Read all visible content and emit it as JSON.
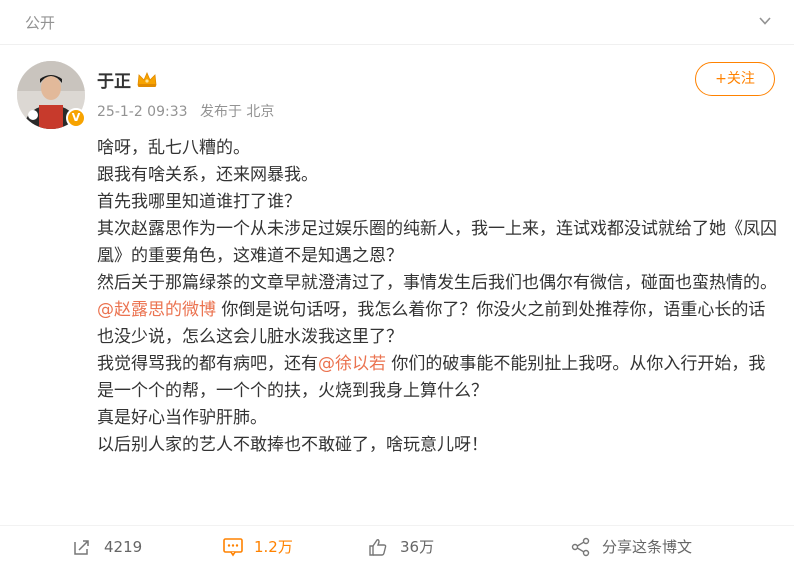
{
  "header": {
    "visibility_label": "公开"
  },
  "author": {
    "name": "于正",
    "verified_badge": "V",
    "timestamp": "25-1-2 09:33",
    "source": "发布于 北京",
    "follow_label": "+关注"
  },
  "post": {
    "lines": [
      {
        "text": "啥呀，乱七八糟的。"
      },
      {
        "text": "跟我有啥关系，还来网暴我。"
      },
      {
        "text": "首先我哪里知道谁打了谁？"
      },
      {
        "text": "其次赵露思作为一个从未涉足过娱乐圈的纯新人，我一上来，连试戏都没试就给了她《凤囚凰》的重要角色，这难道不是知遇之恩？"
      },
      {
        "text": "然后关于那篇绿茶的文章早就澄清过了，事情发生后我们也偶尔有微信，碰面也蛮热情的。"
      },
      {
        "mention": "@赵露思的微博",
        "text": " 你倒是说句话呀，我怎么着你了？你没火之前到处推荐你，语重心长的话也没少说，怎么这会儿脏水泼我这里了？"
      },
      {
        "before": "我觉得骂我的都有病吧，还有",
        "mention": "@徐以若",
        "after": " 你们的破事能不能别扯上我呀。从你入行开始，我是一个个的帮，一个个的扶，火烧到我身上算什么？"
      },
      {
        "text": "真是好心当作驴肝肺。"
      },
      {
        "text": "以后别人家的艺人不敢捧也不敢碰了，啥玩意儿呀！"
      }
    ]
  },
  "actions": {
    "repost": {
      "count": "4219",
      "icon": "share-arrow-icon"
    },
    "comment": {
      "count": "1.2万",
      "icon": "comment-icon"
    },
    "like": {
      "count": "36万",
      "icon": "thumbs-up-icon"
    },
    "share": {
      "label": "分享这条博文",
      "icon": "share-nodes-icon"
    }
  },
  "colors": {
    "accent": "#ff8200",
    "mention": "#eb7350",
    "muted": "#939393"
  }
}
